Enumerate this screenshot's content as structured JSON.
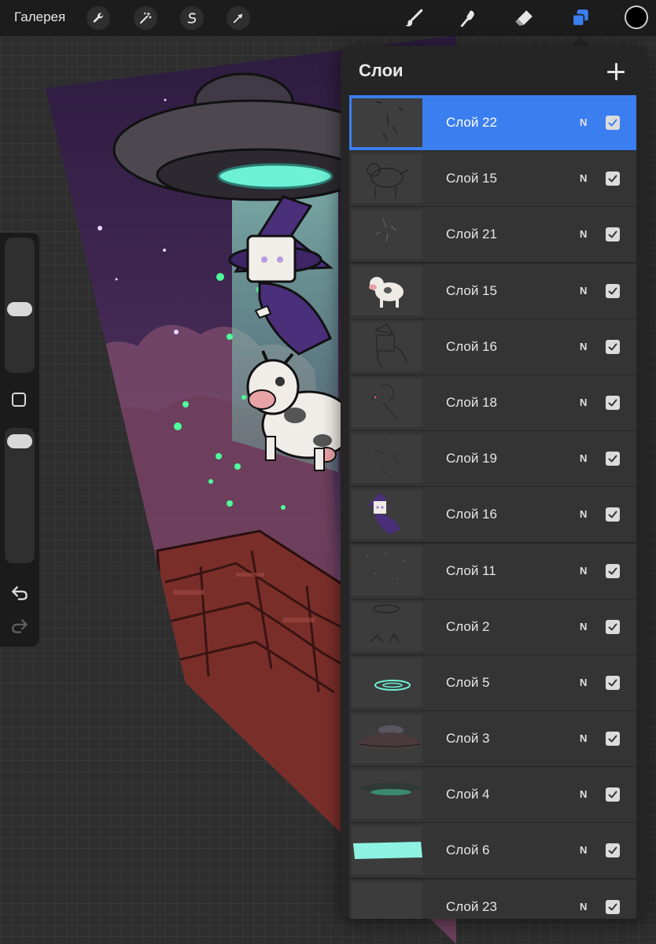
{
  "toolbar": {
    "gallery_label": "Галерея",
    "left_icons": [
      "wrench-icon",
      "magic-wand-icon",
      "selection-icon",
      "arrow-icon"
    ],
    "right_tools": [
      "brush-icon",
      "smudge-icon",
      "eraser-icon",
      "layers-icon"
    ],
    "active_tool": "layers-icon",
    "accent_color": "#3b7ef0",
    "current_color": "#000000"
  },
  "sidebar": {
    "icons": [
      "modify-square-icon",
      "undo-icon",
      "redo-icon"
    ]
  },
  "layers_panel": {
    "title": "Слои",
    "add_icon": "plus-icon",
    "layers": [
      {
        "name": "Слой 22",
        "blend": "N",
        "visible": true,
        "active": true
      },
      {
        "name": "Слой 15",
        "blend": "N",
        "visible": true,
        "active": false
      },
      {
        "name": "Слой 21",
        "blend": "N",
        "visible": true,
        "active": false
      },
      {
        "name": "Слой 15",
        "blend": "N",
        "visible": true,
        "active": false
      },
      {
        "name": "Слой 16",
        "blend": "N",
        "visible": true,
        "active": false
      },
      {
        "name": "Слой 18",
        "blend": "N",
        "visible": true,
        "active": false
      },
      {
        "name": "Слой 19",
        "blend": "N",
        "visible": true,
        "active": false
      },
      {
        "name": "Слой 16",
        "blend": "N",
        "visible": true,
        "active": false
      },
      {
        "name": "Слой 11",
        "blend": "N",
        "visible": true,
        "active": false
      },
      {
        "name": "Слой 2",
        "blend": "N",
        "visible": true,
        "active": false
      },
      {
        "name": "Слой 5",
        "blend": "N",
        "visible": true,
        "active": false
      },
      {
        "name": "Слой 3",
        "blend": "N",
        "visible": true,
        "active": false
      },
      {
        "name": "Слой 4",
        "blend": "N",
        "visible": true,
        "active": false
      },
      {
        "name": "Слой 6",
        "blend": "N",
        "visible": true,
        "active": false
      },
      {
        "name": "Слой 23",
        "blend": "N",
        "visible": true,
        "active": false
      }
    ]
  }
}
